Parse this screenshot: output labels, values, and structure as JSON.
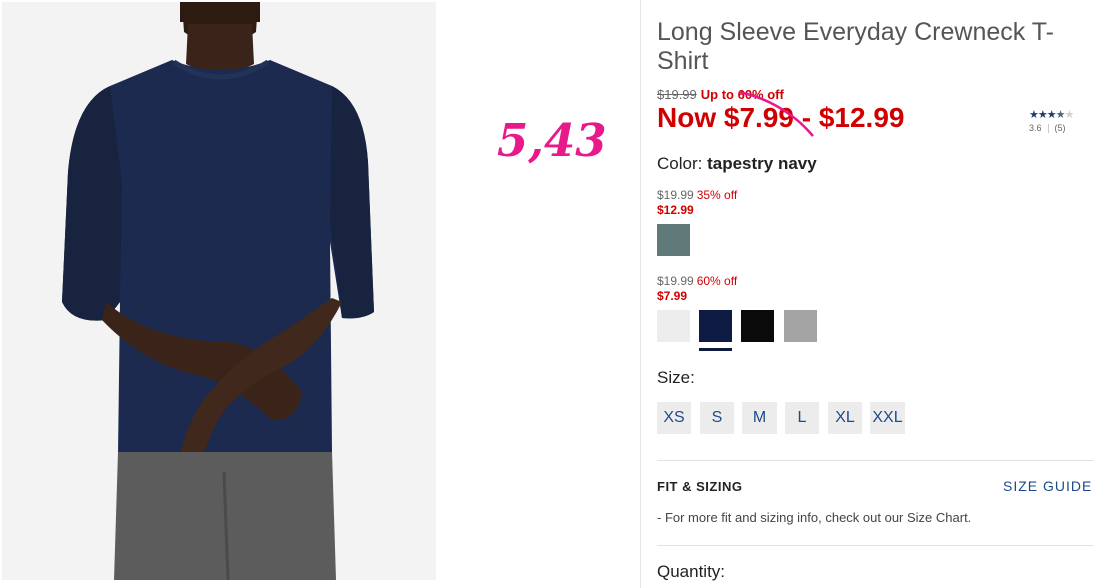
{
  "annotation": {
    "price": "5,43"
  },
  "product": {
    "title": "Long Sleeve Everyday Crewneck T-Shirt",
    "original_price": "$19.99",
    "discount_label": "Up to 60% off",
    "now_price": "Now $7.99 - $12.99",
    "rating": {
      "value": "3.6",
      "count": "(5)",
      "stars_filled": 3.6,
      "stars_max": 5
    },
    "color_label": "Color:",
    "color_value": "tapestry navy"
  },
  "swatch_groups": [
    {
      "orig": "$19.99",
      "pct": "35% off",
      "sale": "$12.99",
      "swatches": [
        {
          "name": "sage",
          "color": "#5f7a78"
        }
      ]
    },
    {
      "orig": "$19.99",
      "pct": "60% off",
      "sale": "$7.99",
      "swatches": [
        {
          "name": "white",
          "color": "#ededed"
        },
        {
          "name": "tapestry navy",
          "color": "#0e1c44",
          "selected": true
        },
        {
          "name": "black",
          "color": "#0a0a0a"
        },
        {
          "name": "grey",
          "color": "#a4a4a4"
        }
      ]
    }
  ],
  "size": {
    "label": "Size:",
    "options": [
      "XS",
      "S",
      "M",
      "L",
      "XL",
      "XXL"
    ]
  },
  "fit": {
    "heading": "FIT & SIZING",
    "guide_link": "SIZE GUIDE",
    "note": "- For more fit and sizing info, check out our Size Chart."
  },
  "quantity_label": "Quantity:",
  "colors": {
    "sale_red": "#d00000",
    "link_blue": "#1e4a8c",
    "annotation_pink": "#e8198b",
    "shirt_navy": "#1b2a4e"
  }
}
